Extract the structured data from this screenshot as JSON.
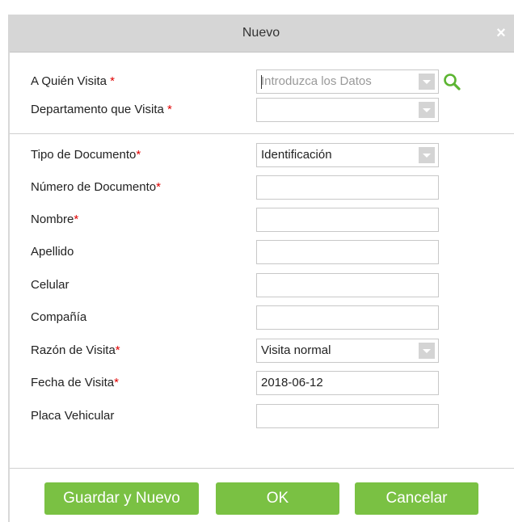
{
  "dialog": {
    "title": "Nuevo",
    "close_label": "×"
  },
  "form": {
    "required_mark": "*",
    "host": {
      "label": "A Quién Visita",
      "placeholder": "Introduzca los Datos"
    },
    "department": {
      "label": "Departamento que Visita",
      "value": ""
    },
    "document_type": {
      "label": "Tipo de Documento",
      "value": "Identificación"
    },
    "document_number": {
      "label": "Número de Documento",
      "value": ""
    },
    "first_name": {
      "label": "Nombre",
      "value": ""
    },
    "last_name": {
      "label": "Apellido",
      "value": ""
    },
    "cellphone": {
      "label": "Celular",
      "value": ""
    },
    "company": {
      "label": "Compañía",
      "value": ""
    },
    "visit_reason": {
      "label": "Razón de Visita",
      "value": "Visita normal"
    },
    "visit_date": {
      "label": "Fecha de Visita",
      "value": "2018-06-12"
    },
    "license_plate": {
      "label": "Placa Vehicular",
      "value": ""
    }
  },
  "buttons": {
    "save_new": "Guardar y Nuevo",
    "ok": "OK",
    "cancel": "Cancelar"
  },
  "colors": {
    "titlebar": "#d6d6d6",
    "button_green": "#7ac143",
    "required_red": "#e00000",
    "search_icon": "#5cb531"
  }
}
